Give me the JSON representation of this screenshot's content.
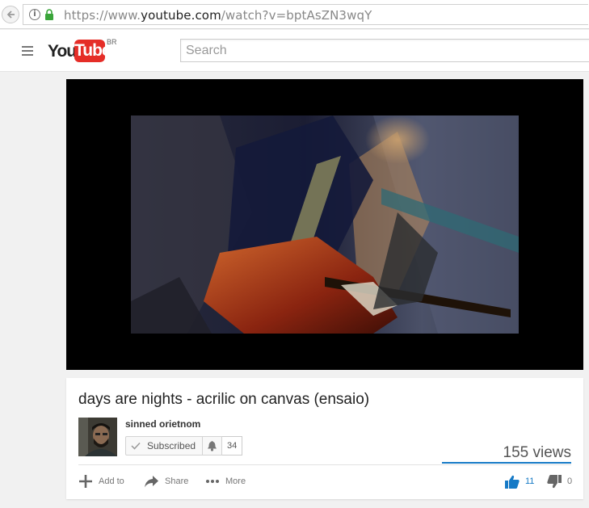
{
  "browser": {
    "url_scheme": "https://www.",
    "url_host": "youtube.com",
    "url_path": "/watch?v=bptAsZN3wqY"
  },
  "header": {
    "logo_you": "You",
    "logo_tube": "Tube",
    "region": "BR",
    "search_placeholder": "Search"
  },
  "video": {
    "title": "days are nights - acrilic on canvas (ensaio)",
    "channel": "sinned orietnom",
    "subscribed_label": "Subscribed",
    "subscriber_count": "34",
    "views": "155 views",
    "like_ratio": 1.0
  },
  "actions": {
    "add_to": "Add to",
    "share": "Share",
    "more": "More",
    "likes": "11",
    "dislikes": "0"
  },
  "colors": {
    "brand_red": "#e52d27",
    "like_blue": "#167ac6",
    "lock_green": "#3aa53a"
  }
}
